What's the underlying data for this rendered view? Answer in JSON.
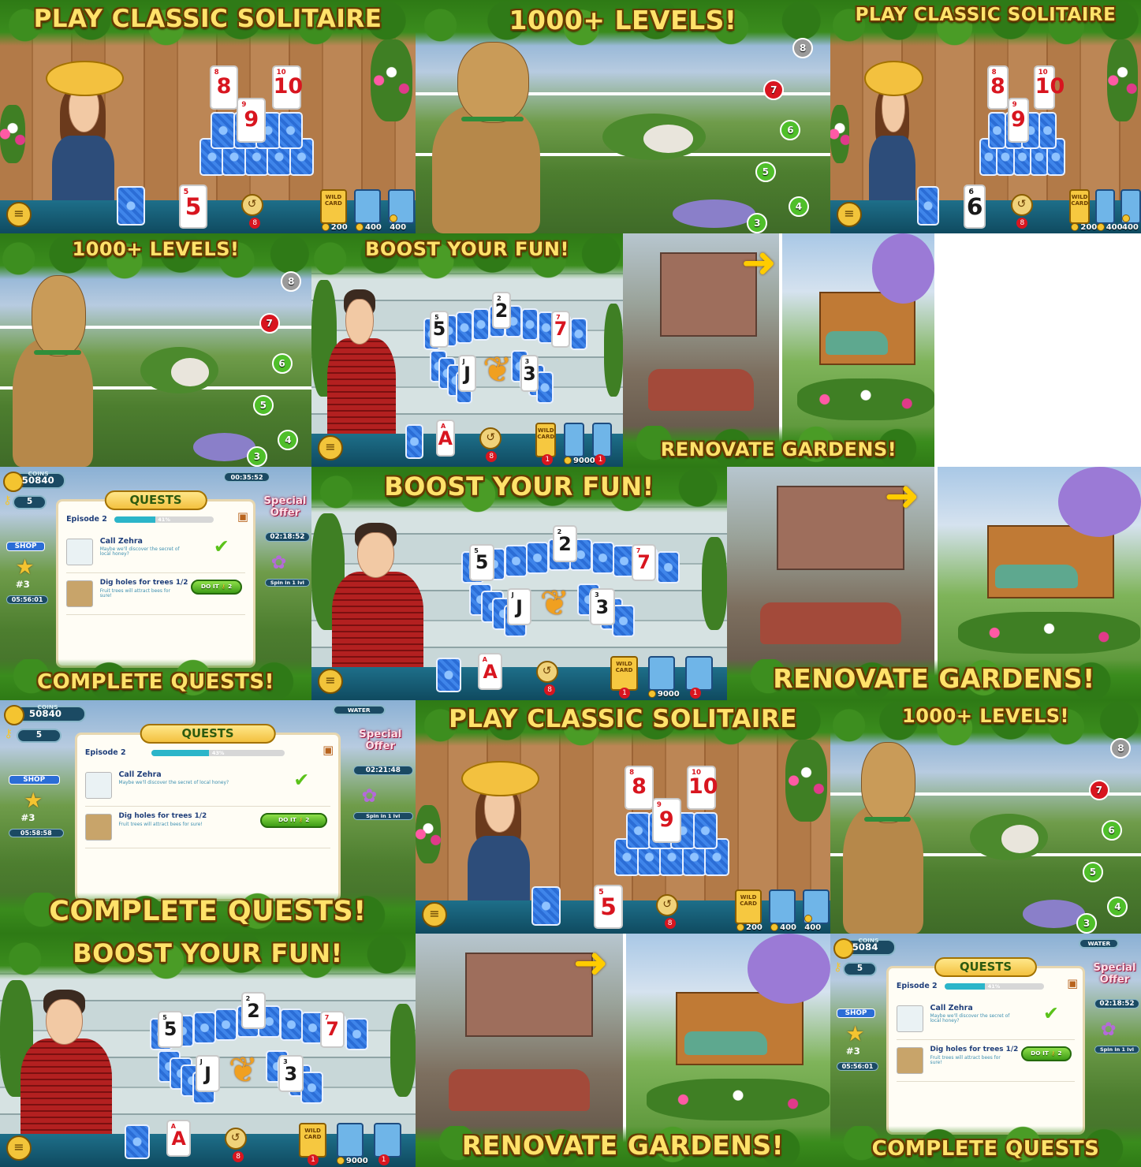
{
  "banners": {
    "solitaire": "PLAY CLASSIC SOLITAIRE",
    "levels": "1000+ LEVELS!",
    "boost": "BOOST YOUR FUN!",
    "renovate": "RENOVATE GARDENS!",
    "quests": "COMPLETE QUESTS!",
    "quests_cut": "COMPLETE QUESTS"
  },
  "solitaire_game": {
    "top_cards": [
      {
        "rank": "8",
        "suit": "♦"
      },
      {
        "rank": "9",
        "suit": "♦"
      },
      {
        "rank": "10",
        "suit": "♦"
      }
    ],
    "draw_card_a": {
      "rank": "5",
      "suit": "♥"
    },
    "draw_card_b": {
      "rank": "6",
      "suit": "♠"
    },
    "undo_count": "8",
    "booster_prices": [
      "200",
      "400",
      "400"
    ],
    "wild_card_label": "WILD CARD"
  },
  "boost_game": {
    "arc_cards": [
      {
        "rank": "5",
        "suit": "♠"
      },
      {
        "rank": "2",
        "suit": "♣"
      },
      {
        "rank": "7",
        "suit": "♦"
      }
    ],
    "mid_cards": [
      {
        "rank": "J",
        "suit": "♠"
      },
      {
        "rank": "3",
        "suit": "♣"
      }
    ],
    "draw_card": {
      "rank": "A",
      "suit": "♦"
    },
    "undo_count": "8",
    "booster_counts": [
      "1",
      "1"
    ],
    "price": "9000",
    "wild_card_label": "WILD CARD"
  },
  "levels_map": {
    "nodes": [
      "8",
      "7",
      "6",
      "5",
      "4",
      "3"
    ]
  },
  "quests_ui": {
    "coins_label": "COINS",
    "coins_value": "50840",
    "coins_cut": "5084",
    "keys": "5",
    "panel_title": "QUESTS",
    "episode_label": "Episode 2",
    "progress_a": "41%",
    "progress_b": "43%",
    "progress_fraction_a": 0.41,
    "progress_fraction_b": 0.43,
    "top_timer": "00:35:52",
    "quest_1_title": "Call Zehra",
    "quest_1_desc": "Maybe we'll discover the secret of local honey?",
    "quest_2_title": "Dig holes for trees 1/2",
    "quest_2_desc": "Fruit trees will attract bees for sure!",
    "do_it_label": "DO IT",
    "do_it_count": "2",
    "special_offer": "Special Offer",
    "offer_timer_a": "02:18:52",
    "offer_timer_b": "02:21:48",
    "spin_label": "Spin in 1 lvl",
    "shop_label": "SHOP",
    "rank_badge": "#3",
    "rank_timer_a": "05:56:01",
    "rank_timer_b": "05:58:58",
    "water_label": "WATER"
  },
  "colors": {
    "banner_text": "#ffe26a",
    "leaf_green": "#3a8c1d",
    "card_red": "#d8151f",
    "card_back_blue": "#2b6dd6"
  }
}
